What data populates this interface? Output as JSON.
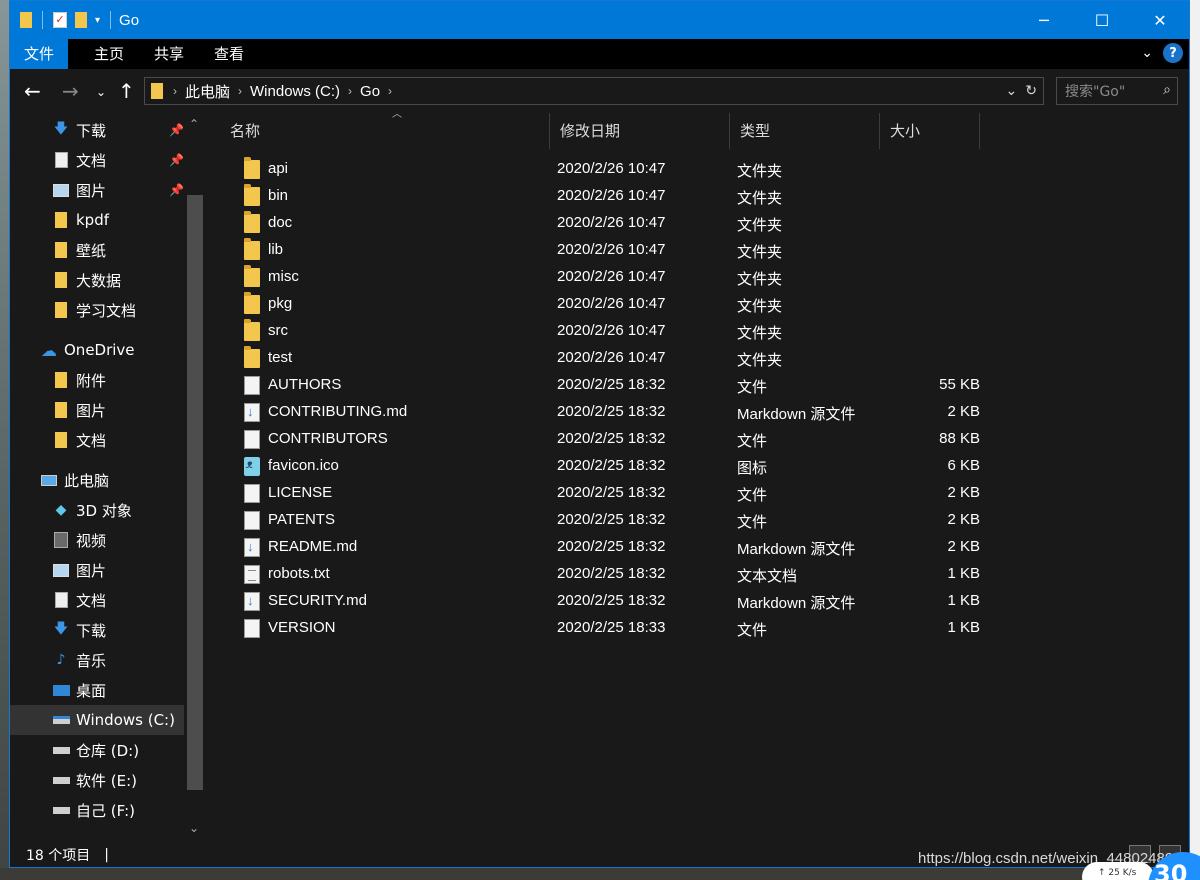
{
  "window": {
    "title": "Go",
    "controls": {
      "minimize": "─",
      "maximize": "☐",
      "close": "✕"
    }
  },
  "ribbon": {
    "tabs": [
      "文件",
      "主页",
      "共享",
      "查看"
    ],
    "active_tab": "文件",
    "help": "?"
  },
  "address": {
    "crumbs": [
      "此电脑",
      "Windows (C:)",
      "Go"
    ],
    "search_placeholder": "搜索\"Go\""
  },
  "nav": {
    "quick_access": [
      {
        "label": "下载",
        "icon": "download-icon",
        "pinned": true
      },
      {
        "label": "文档",
        "icon": "documents-icon",
        "pinned": true
      },
      {
        "label": "图片",
        "icon": "pictures-icon",
        "pinned": true
      },
      {
        "label": "kpdf",
        "icon": "folder-icon",
        "pinned": false
      },
      {
        "label": "壁纸",
        "icon": "folder-icon",
        "pinned": false
      },
      {
        "label": "大数据",
        "icon": "folder-icon",
        "pinned": false
      },
      {
        "label": "学习文档",
        "icon": "folder-icon",
        "pinned": false
      }
    ],
    "onedrive": {
      "label": "OneDrive",
      "items": [
        "附件",
        "图片",
        "文档"
      ]
    },
    "this_pc": {
      "label": "此电脑",
      "items": [
        {
          "label": "3D 对象",
          "icon": "3d-objects-icon"
        },
        {
          "label": "视频",
          "icon": "videos-icon"
        },
        {
          "label": "图片",
          "icon": "pictures-icon"
        },
        {
          "label": "文档",
          "icon": "documents-icon"
        },
        {
          "label": "下载",
          "icon": "download-icon"
        },
        {
          "label": "音乐",
          "icon": "music-icon"
        },
        {
          "label": "桌面",
          "icon": "desktop-icon"
        },
        {
          "label": "Windows (C:)",
          "icon": "windows-drive-icon",
          "selected": true
        },
        {
          "label": "仓库 (D:)",
          "icon": "drive-icon"
        },
        {
          "label": "软件 (E:)",
          "icon": "drive-icon"
        },
        {
          "label": "自己 (F:)",
          "icon": "drive-icon"
        }
      ]
    }
  },
  "columns": {
    "name": "名称",
    "date": "修改日期",
    "type": "类型",
    "size": "大小"
  },
  "files": [
    {
      "name": "api",
      "date": "2020/2/26 10:47",
      "type": "文件夹",
      "size": "",
      "kind": "folder"
    },
    {
      "name": "bin",
      "date": "2020/2/26 10:47",
      "type": "文件夹",
      "size": "",
      "kind": "folder"
    },
    {
      "name": "doc",
      "date": "2020/2/26 10:47",
      "type": "文件夹",
      "size": "",
      "kind": "folder"
    },
    {
      "name": "lib",
      "date": "2020/2/26 10:47",
      "type": "文件夹",
      "size": "",
      "kind": "folder"
    },
    {
      "name": "misc",
      "date": "2020/2/26 10:47",
      "type": "文件夹",
      "size": "",
      "kind": "folder"
    },
    {
      "name": "pkg",
      "date": "2020/2/26 10:47",
      "type": "文件夹",
      "size": "",
      "kind": "folder"
    },
    {
      "name": "src",
      "date": "2020/2/26 10:47",
      "type": "文件夹",
      "size": "",
      "kind": "folder"
    },
    {
      "name": "test",
      "date": "2020/2/26 10:47",
      "type": "文件夹",
      "size": "",
      "kind": "folder"
    },
    {
      "name": "AUTHORS",
      "date": "2020/2/25 18:32",
      "type": "文件",
      "size": "55 KB",
      "kind": "doc"
    },
    {
      "name": "CONTRIBUTING.md",
      "date": "2020/2/25 18:32",
      "type": "Markdown 源文件",
      "size": "2 KB",
      "kind": "md"
    },
    {
      "name": "CONTRIBUTORS",
      "date": "2020/2/25 18:32",
      "type": "文件",
      "size": "88 KB",
      "kind": "doc"
    },
    {
      "name": "favicon.ico",
      "date": "2020/2/25 18:32",
      "type": "图标",
      "size": "6 KB",
      "kind": "ico"
    },
    {
      "name": "LICENSE",
      "date": "2020/2/25 18:32",
      "type": "文件",
      "size": "2 KB",
      "kind": "doc"
    },
    {
      "name": "PATENTS",
      "date": "2020/2/25 18:32",
      "type": "文件",
      "size": "2 KB",
      "kind": "doc"
    },
    {
      "name": "README.md",
      "date": "2020/2/25 18:32",
      "type": "Markdown 源文件",
      "size": "2 KB",
      "kind": "md"
    },
    {
      "name": "robots.txt",
      "date": "2020/2/25 18:32",
      "type": "文本文档",
      "size": "1 KB",
      "kind": "txt"
    },
    {
      "name": "SECURITY.md",
      "date": "2020/2/25 18:32",
      "type": "Markdown 源文件",
      "size": "1 KB",
      "kind": "md"
    },
    {
      "name": "VERSION",
      "date": "2020/2/25 18:33",
      "type": "文件",
      "size": "1 KB",
      "kind": "doc"
    }
  ],
  "status": {
    "item_count": "18 个项目"
  },
  "overlay": {
    "watermark": "https://blog.csdn.net/weixin_44802489",
    "speed": "↑ 25 K/s",
    "speed_badge": "30"
  },
  "colors": {
    "accent": "#0078d7",
    "background": "#191919",
    "folder": "#f3c74d"
  }
}
